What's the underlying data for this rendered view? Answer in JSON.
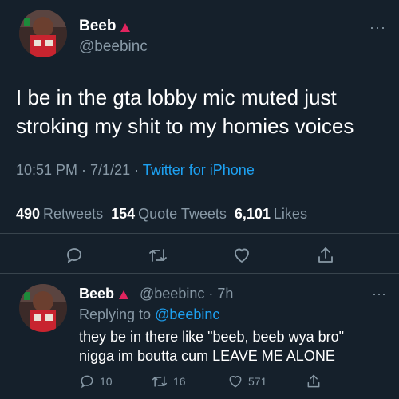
{
  "tweet": {
    "display_name": "Beeb",
    "handle": "@beebinc",
    "more": "···",
    "text": "I be in the gta lobby mic muted just stroking my shit to my homies voices",
    "time": "10:51 PM · 7/1/21 · ",
    "source": "Twitter for iPhone"
  },
  "stats": {
    "retweets_count": "490",
    "retweets_label": "Retweets",
    "quotes_count": "154",
    "quotes_label": "Quote Tweets",
    "likes_count": "6,101",
    "likes_label": "Likes"
  },
  "reply": {
    "display_name": "Beeb",
    "handle_time": "@beebinc · 7h",
    "more": "···",
    "replying_prefix": "Replying to ",
    "replying_handle": "@beebinc",
    "text_line1": "they be in there like \"beeb, beeb wya bro\"",
    "text_line2": "nigga im boutta cum LEAVE ME ALONE",
    "reply_count": "10",
    "retweet_count": "16",
    "like_count": "571"
  },
  "colors": {
    "background": "#15202b",
    "secondary_text": "#8899a6",
    "link": "#1da1f2",
    "badge_red": "#e0245e",
    "divider": "#38444d"
  },
  "icons": [
    "more-icon",
    "reply-icon",
    "retweet-icon",
    "like-icon",
    "share-icon",
    "red-triangle-icon"
  ]
}
